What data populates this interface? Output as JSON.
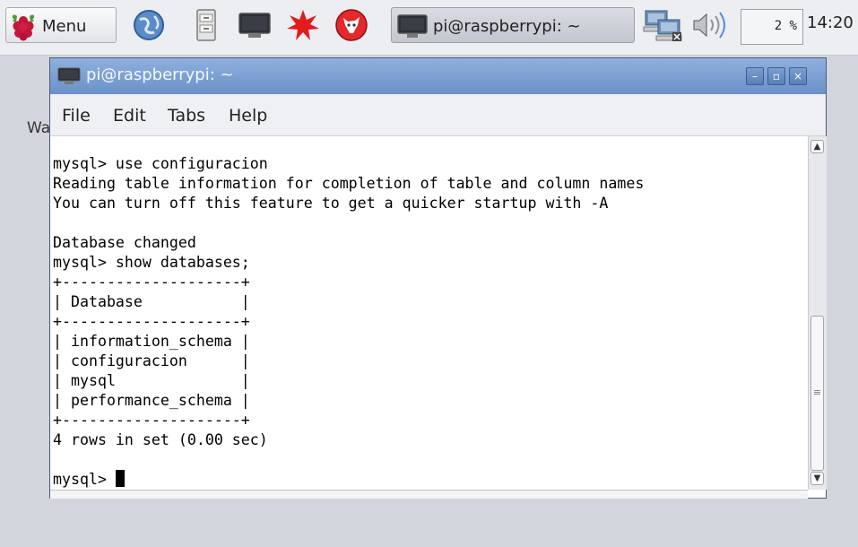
{
  "panel": {
    "menu_label": "Menu",
    "launchers": [
      "web-browser-icon",
      "file-manager-icon",
      "terminal-icon",
      "wolfram-icon",
      "mathematica-icon"
    ],
    "task_label": "pi@raspberrypi: ~",
    "cpu_value": "2 %",
    "clock": "14:20"
  },
  "desktop": {
    "partial_text": "Wa"
  },
  "window": {
    "title": "pi@raspberrypi: ~",
    "menu": [
      "File",
      "Edit",
      "Tabs",
      "Help"
    ],
    "terminal_lines": [
      "mysql> use configuracion",
      "Reading table information for completion of table and column names",
      "You can turn off this feature to get a quicker startup with -A",
      "",
      "Database changed",
      "mysql> show databases;",
      "+--------------------+",
      "| Database           |",
      "+--------------------+",
      "| information_schema |",
      "| configuracion      |",
      "| mysql              |",
      "| performance_schema |",
      "+--------------------+",
      "4 rows in set (0.00 sec)",
      ""
    ],
    "prompt": "mysql> "
  },
  "colors": {
    "titlebar": "#7a9fd4",
    "panel_bg": "#eceef2",
    "desktop_bg": "#d3d5dc"
  }
}
